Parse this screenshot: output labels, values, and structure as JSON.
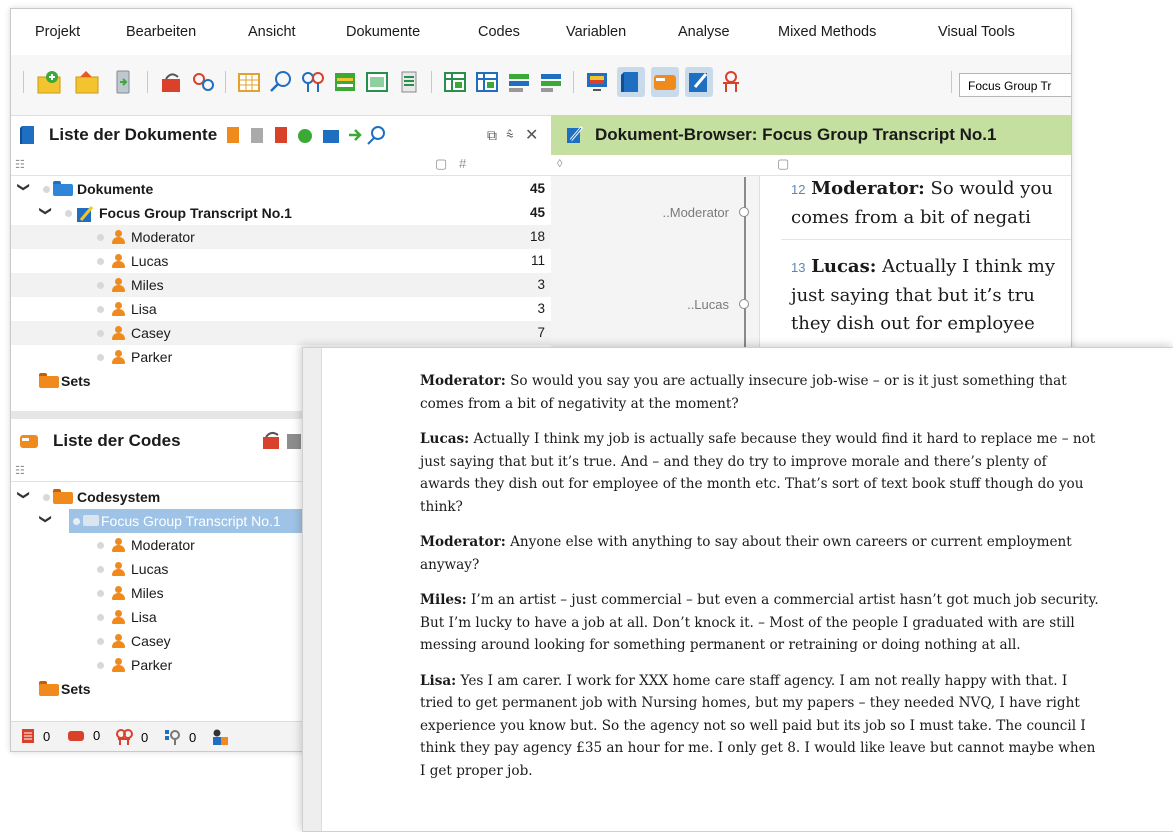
{
  "menu": [
    "Projekt",
    "Bearbeiten",
    "Ansicht",
    "Dokumente",
    "Codes",
    "Variablen",
    "Analyse",
    "Mixed Methods",
    "Visual Tools"
  ],
  "toolbar": {
    "document_select": "Focus Group Tr"
  },
  "doc_panel": {
    "title": "Liste der Dokumente",
    "root": {
      "label": "Dokumente",
      "count": "45"
    },
    "document": {
      "label": "Focus Group Transcript No.1",
      "count": "45"
    },
    "speakers": [
      {
        "label": "Moderator",
        "count": "18"
      },
      {
        "label": "Lucas",
        "count": "11"
      },
      {
        "label": "Miles",
        "count": "3"
      },
      {
        "label": "Lisa",
        "count": "3"
      },
      {
        "label": "Casey",
        "count": "7"
      },
      {
        "label": "Parker",
        "count": ""
      }
    ],
    "sets_label": "Sets"
  },
  "doc_browser": {
    "title": "Dokument-Browser: Focus Group Transcript No.1",
    "segments": [
      {
        "label": "..Moderator"
      },
      {
        "label": "..Lucas"
      }
    ],
    "paragraphs": [
      {
        "num": "12",
        "speaker": "Moderator:",
        "line1": " So would you",
        "line2": "comes from a bit of negati"
      },
      {
        "num": "13",
        "speaker": "Lucas:",
        "line1": " Actually I think my",
        "line2": "just saying that but it’s tru",
        "line3": "they dish out for employee"
      }
    ]
  },
  "code_panel": {
    "title": "Liste der Codes",
    "root": {
      "label": "Codesystem"
    },
    "selected": {
      "label": "Focus Group Transcript No.1"
    },
    "codes": [
      {
        "label": "Moderator"
      },
      {
        "label": "Lucas"
      },
      {
        "label": "Miles"
      },
      {
        "label": "Lisa"
      },
      {
        "label": "Casey"
      },
      {
        "label": "Parker"
      }
    ],
    "sets_label": "Sets"
  },
  "statusbar": [
    {
      "icon": "document-icon",
      "value": "0"
    },
    {
      "icon": "code-icon",
      "value": "0"
    },
    {
      "icon": "retrieved-segments-icon",
      "value": "0"
    },
    {
      "icon": "activated-codes-icon",
      "value": "0"
    }
  ],
  "transcript": [
    {
      "speaker": "Moderator:",
      "text": " So would you say you are actually insecure job-wise – or is it just something that comes from a bit of negativity at the moment?"
    },
    {
      "speaker": "Lucas:",
      "text": " Actually I think my job is actually safe because they would find it hard to replace me – not just saying that but it’s true.  And – and they do try to improve morale and there’s plenty of awards they dish out for employee of the month etc.  That’s sort of text book stuff though do you think?"
    },
    {
      "speaker": "Moderator:",
      "text": " Anyone else with anything to say about their own careers or current employment anyway?"
    },
    {
      "speaker": "Miles:",
      "text": " I’m an artist – just commercial – but even a commercial artist hasn’t got much job security.  But I’m lucky to have a job at all.  Don’t knock it.  – Most of the people I graduated with are still messing around looking for something permanent or retraining or doing nothing at all."
    },
    {
      "speaker": "Lisa:",
      "text": " Yes I am carer.  I work for XXX home care staff agency.  I am not really happy with that.  I tried to get permanent job with Nursing homes, but my papers – they needed NVQ, I have right experience you know but.  So the agency not so well paid but its job so I must take.  The council I think they pay agency £35 an hour for me.  I only get 8.  I would like leave but cannot maybe when I get proper job."
    }
  ],
  "colors": {
    "accent_green": "#c4df9f",
    "orange": "#f08a1c",
    "blue": "#1e6fc1",
    "selection": "#9fc3e6"
  }
}
